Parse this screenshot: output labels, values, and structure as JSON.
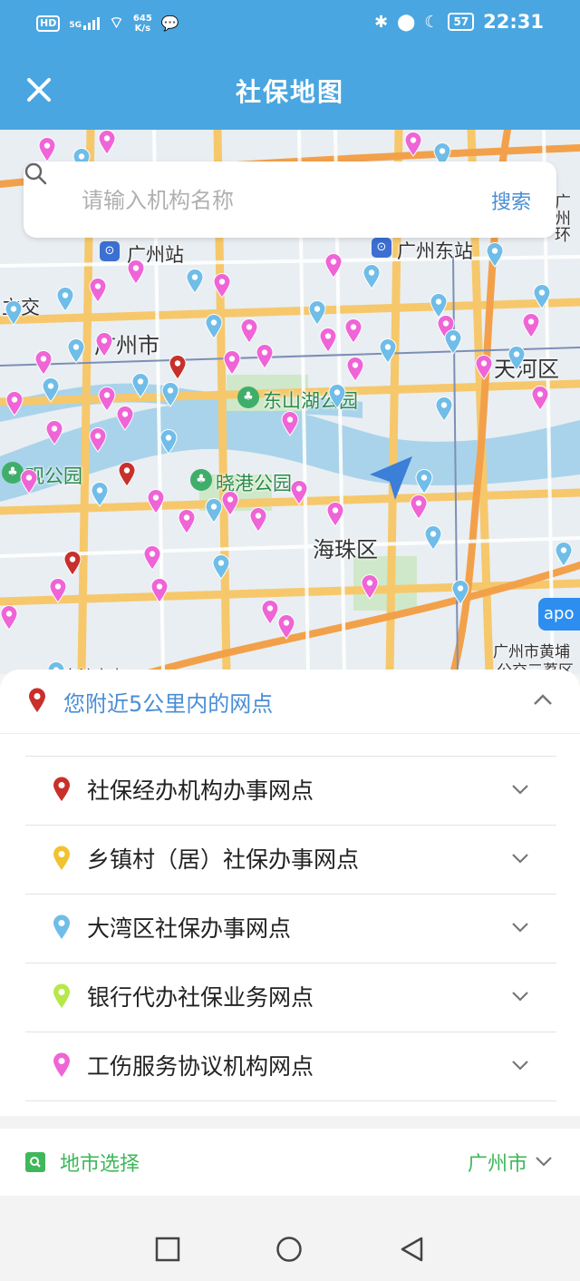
{
  "status_bar": {
    "hd": "HD",
    "signal": "5G",
    "net_speed_value": "645",
    "net_speed_unit": "K/s",
    "battery": "57",
    "time": "22:31"
  },
  "header": {
    "title": "社保地图"
  },
  "search": {
    "placeholder": "请输入机构名称",
    "button": "搜索"
  },
  "map": {
    "labels": {
      "guangzhou_station": "广州站",
      "guangzhou_east_station": "广州东站",
      "guangzhou_city": "广州市",
      "tianhe": "天河区",
      "dongshan_park": "东山湖公园",
      "xiaogang_park": "晓港公园",
      "haizhu": "海珠区",
      "liwan_park": "观公园",
      "liujiao": "立交",
      "guangzhou_ring": "广州环",
      "huangpu_park": "广州市黄埔",
      "huangpu_park2": "公交三荔区",
      "bottom_left": "东沙市交"
    },
    "logo": "apo"
  },
  "nearby": {
    "title": "您附近5公里内的网点"
  },
  "categories": [
    {
      "label": "社保经办机构办事网点",
      "color": "#c8302b"
    },
    {
      "label": "乡镇村（居）社保办事网点",
      "color": "#f2c230"
    },
    {
      "label": "大湾区社保办事网点",
      "color": "#6fbde8"
    },
    {
      "label": "银行代办社保业务网点",
      "color": "#b6e84a"
    },
    {
      "label": "工伤服务协议机构网点",
      "color": "#ef64d6"
    }
  ],
  "city": {
    "label": "地市选择",
    "value": "广州市"
  },
  "colors": {
    "primary": "#4aa6e0",
    "accent_blue": "#4a8ed6",
    "green": "#3fb75a"
  }
}
